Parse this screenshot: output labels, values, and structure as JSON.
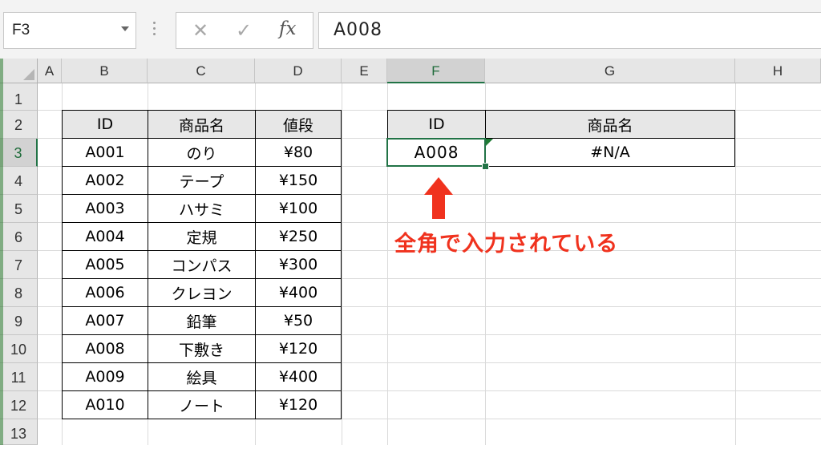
{
  "formula_bar": {
    "name_box": "F3",
    "cancel_icon": "✕",
    "enter_icon": "✓",
    "fx_label": "fx",
    "formula_value": "A008"
  },
  "columns": [
    "A",
    "B",
    "C",
    "D",
    "E",
    "F",
    "G",
    "H"
  ],
  "rows": [
    "1",
    "2",
    "3",
    "4",
    "5",
    "6",
    "7",
    "8",
    "9",
    "10",
    "11",
    "12",
    "13"
  ],
  "products_table": {
    "headers": [
      "ID",
      "商品名",
      "値段"
    ],
    "rows": [
      [
        "A001",
        "のり",
        "¥80"
      ],
      [
        "A002",
        "テープ",
        "¥150"
      ],
      [
        "A003",
        "ハサミ",
        "¥100"
      ],
      [
        "A004",
        "定規",
        "¥250"
      ],
      [
        "A005",
        "コンパス",
        "¥300"
      ],
      [
        "A006",
        "クレヨン",
        "¥400"
      ],
      [
        "A007",
        "鉛筆",
        "¥50"
      ],
      [
        "A008",
        "下敷き",
        "¥120"
      ],
      [
        "A009",
        "絵具",
        "¥400"
      ],
      [
        "A010",
        "ノート",
        "¥120"
      ]
    ]
  },
  "lookup_table": {
    "headers": [
      "ID",
      "商品名"
    ],
    "id_value": "A008",
    "result_value": "#N/A"
  },
  "annotation": {
    "text": "全角で入力されている",
    "color": "#f0321e"
  },
  "colors": {
    "accent": "#217346",
    "annotation": "#f0321e"
  }
}
